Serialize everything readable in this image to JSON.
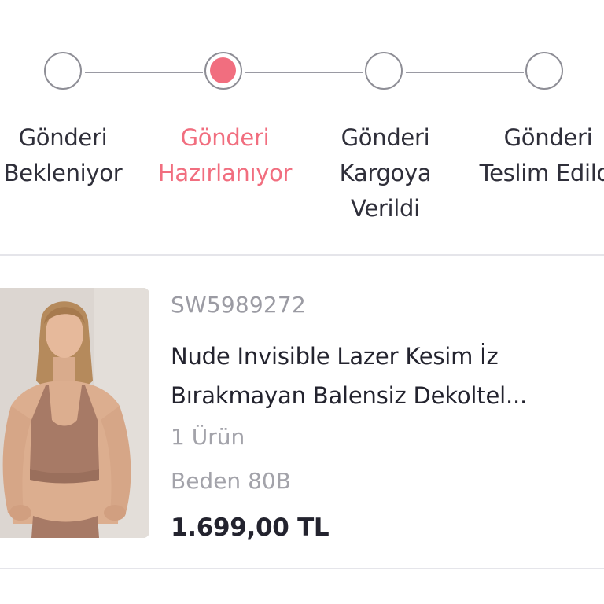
{
  "stepper": {
    "steps": [
      {
        "label": "Gönderi\nBekleniyor",
        "active": false
      },
      {
        "label": "Gönderi\nHazırlanıyor",
        "active": true
      },
      {
        "label": "Gönderi\nKargoya\nVerildi",
        "active": false
      },
      {
        "label": "Gönderi\nTeslim Edildi",
        "active": false
      }
    ],
    "active_color": "#f16e7f"
  },
  "product": {
    "sku": "SW5989272",
    "name": "Nude Invisible Lazer Kesim İz Bırakmayan Balensiz Dekoltel...",
    "quantity": "1 Ürün",
    "size": "Beden 80B",
    "price": "1.699,00 TL"
  }
}
